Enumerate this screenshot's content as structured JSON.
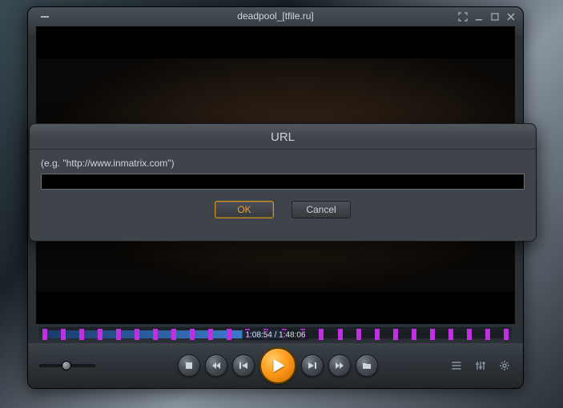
{
  "window": {
    "title": "deadpool_[tfile.ru]"
  },
  "seek": {
    "timestamp": "1:08:54 / 1:48:06"
  },
  "dialog": {
    "title": "URL",
    "hint": "(e.g. \"http://www.inmatrix.com\")",
    "input_value": "",
    "ok": "OK",
    "cancel": "Cancel"
  }
}
